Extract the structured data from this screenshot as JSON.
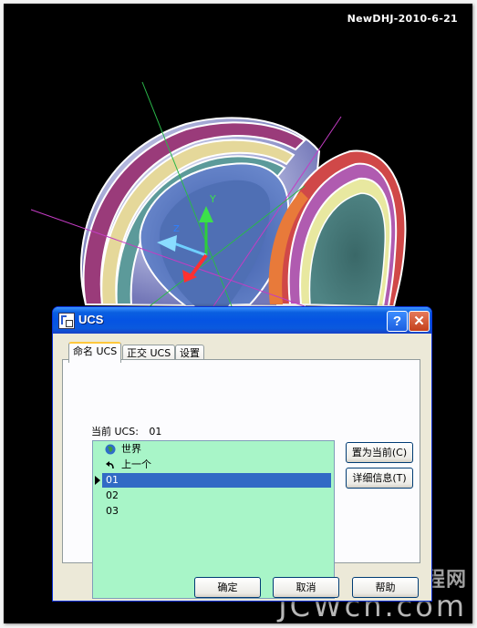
{
  "signature": "NewDHJ-2010-6-21",
  "watermark": {
    "cn": "中国教程网",
    "en": "JCWcn.com"
  },
  "dialog": {
    "title": "UCS",
    "help_glyph": "?",
    "close_glyph": "✕",
    "tabs": [
      "命名 UCS",
      "正交 UCS",
      "设置"
    ],
    "current_label": "当前 UCS:",
    "current_value": "01",
    "list_items": [
      "世界",
      "上一个",
      "01",
      "02",
      "03"
    ],
    "selected_item": "01",
    "buttons": {
      "set_current": "置为当前(C)",
      "details": "详细信息(T)",
      "ok": "确定",
      "cancel": "取消",
      "help": "帮助"
    }
  },
  "colors": {
    "list_background": "#a8f5c8",
    "selection": "#316ac5",
    "titlebar": "#0554e3"
  },
  "icons": [
    "ucs-dialog-icon",
    "help-icon",
    "close-icon",
    "globe-icon",
    "undo-arrow-icon",
    "current-arrow-icon"
  ]
}
